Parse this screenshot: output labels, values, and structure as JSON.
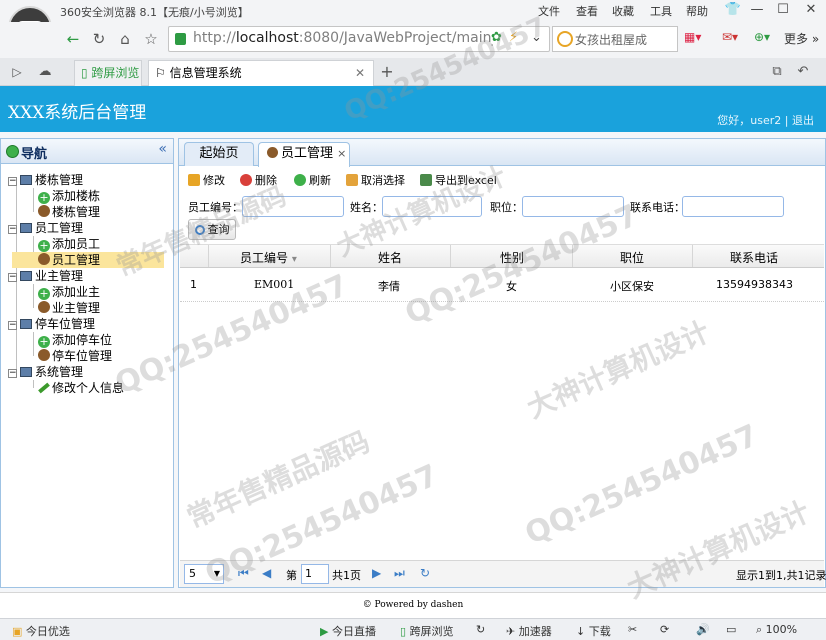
{
  "browser": {
    "window_title": "360安全浏览器 8.1【无痕/小号浏览】",
    "menu": [
      "文件",
      "查看",
      "收藏",
      "工具",
      "帮助"
    ],
    "url_prefix": "http://",
    "url_host": "localhost",
    "url_rest": ":8080/JavaWebProject/main_x",
    "search_text": "女孩出租屋成",
    "more_label": "更多",
    "tabs": [
      "跨屏浏览",
      "信息管理系统"
    ]
  },
  "app": {
    "title": "XXX系统后台管理",
    "greeting": "您好，user2",
    "divider": "|",
    "logout": "退出"
  },
  "nav": {
    "title": "导航",
    "collapse": "«",
    "groups": [
      {
        "label": "楼栋管理",
        "items": [
          "添加楼栋",
          "楼栋管理"
        ]
      },
      {
        "label": "员工管理",
        "items": [
          "添加员工",
          "员工管理"
        ]
      },
      {
        "label": "业主管理",
        "items": [
          "添加业主",
          "业主管理"
        ]
      },
      {
        "label": "停车位管理",
        "items": [
          "添加停车位",
          "停车位管理"
        ]
      },
      {
        "label": "系统管理",
        "items": [
          "修改个人信息"
        ]
      }
    ]
  },
  "main": {
    "tabs": [
      "起始页",
      "员工管理"
    ],
    "tab_close": "×",
    "toolbar": [
      "修改",
      "删除",
      "刷新",
      "取消选择",
      "导出到excel"
    ],
    "search": {
      "labels": [
        "员工编号：",
        "姓名：",
        "职位：",
        "联系电话："
      ],
      "button": "查询"
    },
    "grid": {
      "columns": [
        "员工编号",
        "姓名",
        "性别",
        "职位",
        "联系电话"
      ],
      "sort_mark": "▾",
      "rows": [
        [
          "1",
          "EM001",
          "李倩",
          "女",
          "小区保安",
          "13594938343"
        ]
      ]
    },
    "pager": {
      "page_size": "5",
      "page_label": "第",
      "page": "1",
      "total_pages": "共1页",
      "summary": "显示1到1,共1记录"
    }
  },
  "footer": {
    "text": "© Powered by dashen"
  },
  "statusbar": {
    "left": "今日优选",
    "items": [
      "今日直播",
      "跨屏浏览",
      "加速器",
      "下载"
    ],
    "zoom": "100%"
  },
  "watermark": {
    "qq": "QQ:254540457",
    "a": "大神计算机设计",
    "b": "常年售精品源码"
  }
}
